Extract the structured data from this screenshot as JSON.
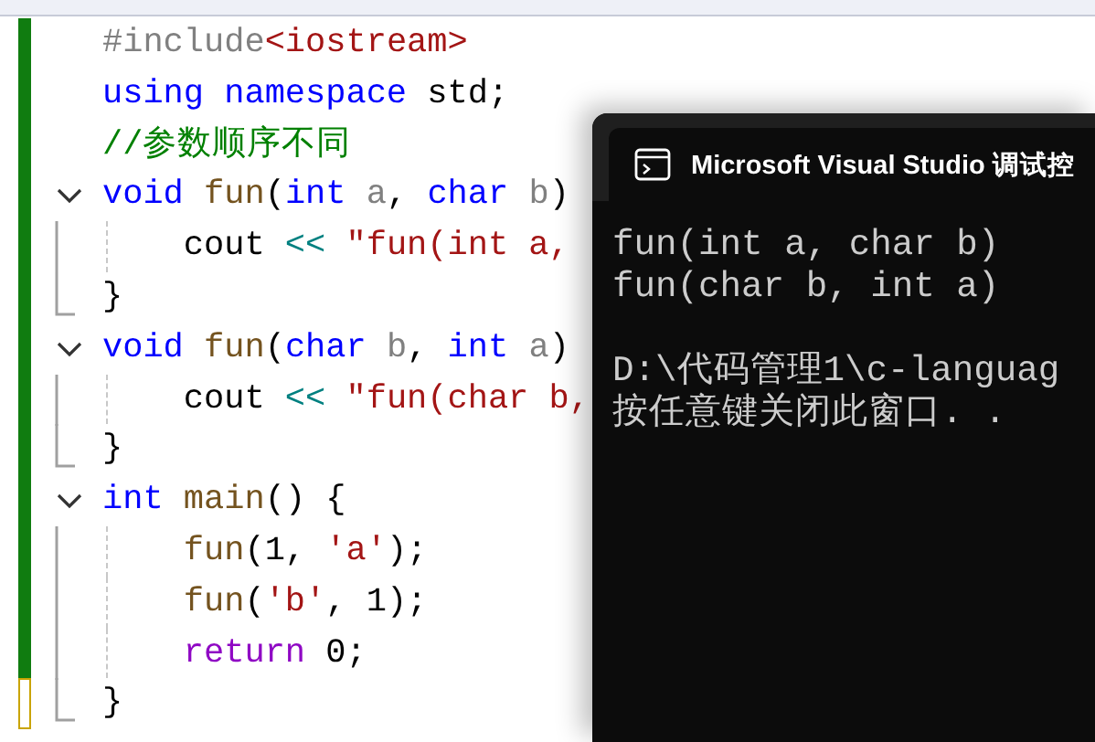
{
  "editor": {
    "lines": [
      {
        "saved": true,
        "tokens": [
          {
            "kind": "preproc",
            "text": "#include"
          },
          {
            "kind": "header",
            "text": "<iostream>"
          }
        ]
      },
      {
        "saved": true,
        "tokens": [
          {
            "kind": "keyword",
            "text": "using namespace "
          },
          {
            "kind": "plain",
            "text": "std;"
          }
        ]
      },
      {
        "saved": true,
        "tokens": [
          {
            "kind": "comment",
            "text": "//参数顺序不同"
          }
        ]
      },
      {
        "saved": true,
        "expanded": true,
        "tokens": [
          {
            "kind": "keyword",
            "text": "void "
          },
          {
            "kind": "func",
            "text": "fun"
          },
          {
            "kind": "plain",
            "text": "("
          },
          {
            "kind": "keyword",
            "text": "int "
          },
          {
            "kind": "param",
            "text": "a"
          },
          {
            "kind": "plain",
            "text": ", "
          },
          {
            "kind": "keyword",
            "text": "char "
          },
          {
            "kind": "param",
            "text": "b"
          },
          {
            "kind": "plain",
            "text": ")"
          }
        ],
        "children": [
          {
            "saved": true,
            "tokens": [
              {
                "kind": "plain",
                "text": "    cout "
              },
              {
                "kind": "operator",
                "text": "<< "
              },
              {
                "kind": "string",
                "text": "\"fun(int a,"
              }
            ]
          },
          {
            "saved": true,
            "tokens": [
              {
                "kind": "plain",
                "text": "}"
              }
            ]
          }
        ]
      },
      {
        "saved": true,
        "expanded": true,
        "tokens": [
          {
            "kind": "keyword",
            "text": "void "
          },
          {
            "kind": "func",
            "text": "fun"
          },
          {
            "kind": "plain",
            "text": "("
          },
          {
            "kind": "keyword",
            "text": "char "
          },
          {
            "kind": "param",
            "text": "b"
          },
          {
            "kind": "plain",
            "text": ", "
          },
          {
            "kind": "keyword",
            "text": "int "
          },
          {
            "kind": "param",
            "text": "a"
          },
          {
            "kind": "plain",
            "text": ")"
          }
        ],
        "children": [
          {
            "saved": true,
            "tokens": [
              {
                "kind": "plain",
                "text": "    cout "
              },
              {
                "kind": "operator",
                "text": "<< "
              },
              {
                "kind": "string",
                "text": "\"fun(char b,"
              }
            ]
          },
          {
            "saved": true,
            "tokens": [
              {
                "kind": "plain",
                "text": "}"
              }
            ]
          }
        ]
      },
      {
        "saved": true,
        "expanded": true,
        "tokens": [
          {
            "kind": "keyword",
            "text": "int "
          },
          {
            "kind": "func",
            "text": "main"
          },
          {
            "kind": "plain",
            "text": "() {"
          }
        ],
        "children": [
          {
            "saved": true,
            "tokens": [
              {
                "kind": "func",
                "text": "    fun"
              },
              {
                "kind": "plain",
                "text": "(1, "
              },
              {
                "kind": "string",
                "text": "'a'"
              },
              {
                "kind": "plain",
                "text": ");"
              }
            ]
          },
          {
            "saved": true,
            "tokens": [
              {
                "kind": "func",
                "text": "    fun"
              },
              {
                "kind": "plain",
                "text": "("
              },
              {
                "kind": "string",
                "text": "'b'"
              },
              {
                "kind": "plain",
                "text": ", 1);"
              }
            ]
          },
          {
            "saved": true,
            "tokens": [
              {
                "kind": "control",
                "text": "    return "
              },
              {
                "kind": "plain",
                "text": "0;"
              }
            ]
          },
          {
            "saved": false,
            "tokens": [
              {
                "kind": "plain",
                "text": "}"
              }
            ]
          }
        ]
      }
    ]
  },
  "console": {
    "title": "Microsoft Visual Studio 调试控",
    "blocks": [
      [
        "fun(int a, char b)",
        "fun(char b, int a)"
      ],
      [
        "D:\\代码管理1\\c-languag",
        "按任意键关闭此窗口. ."
      ]
    ]
  }
}
